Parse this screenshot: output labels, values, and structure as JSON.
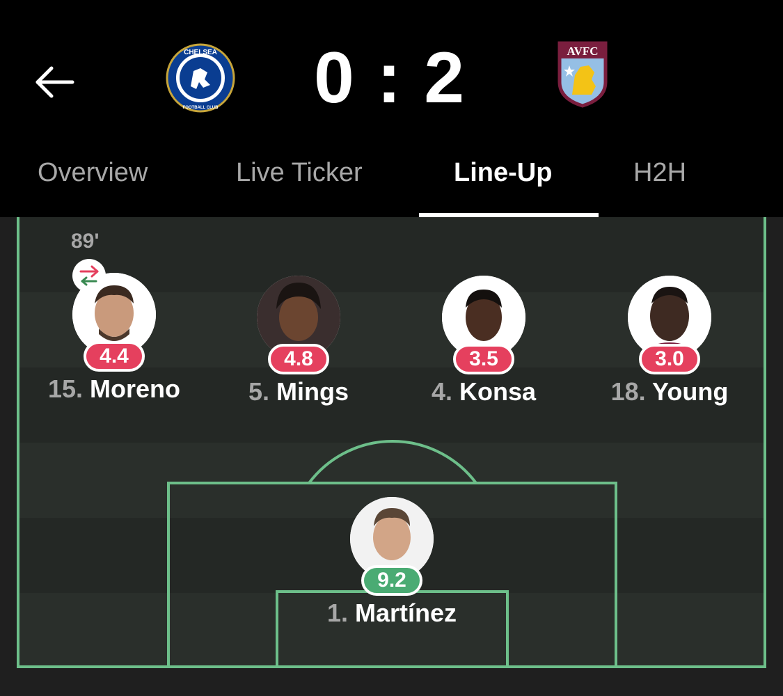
{
  "header": {
    "back_icon": "back-arrow-icon",
    "home_team": {
      "crest_text_top": "CHELSEA",
      "crest_text_bottom": "FOOTBALL CLUB"
    },
    "away_team": {
      "crest_text": "AVFC"
    },
    "score": "0 : 2"
  },
  "tabs": [
    {
      "label": "Overview",
      "active": false
    },
    {
      "label": "Live Ticker",
      "active": false
    },
    {
      "label": "Line-Up",
      "active": true
    },
    {
      "label": "H2H",
      "active": false
    }
  ],
  "lineup": {
    "substitution_time": "89'",
    "substitution_icon": "substitution-arrows-icon",
    "players": [
      {
        "number": "15.",
        "name": "Moreno",
        "rating": "4.4",
        "rating_color": "#e5405e"
      },
      {
        "number": "5.",
        "name": "Mings",
        "rating": "4.8",
        "rating_color": "#e5405e"
      },
      {
        "number": "4.",
        "name": "Konsa",
        "rating": "3.5",
        "rating_color": "#e5405e"
      },
      {
        "number": "18.",
        "name": "Young",
        "rating": "3.0",
        "rating_color": "#e5405e"
      },
      {
        "number": "1.",
        "name": "Martínez",
        "rating": "9.2",
        "rating_color": "#4aab73"
      }
    ]
  },
  "colors": {
    "pitch_line": "#6dbf8a",
    "pitch_dark": "#1f2320",
    "pitch_light": "#262b27"
  }
}
